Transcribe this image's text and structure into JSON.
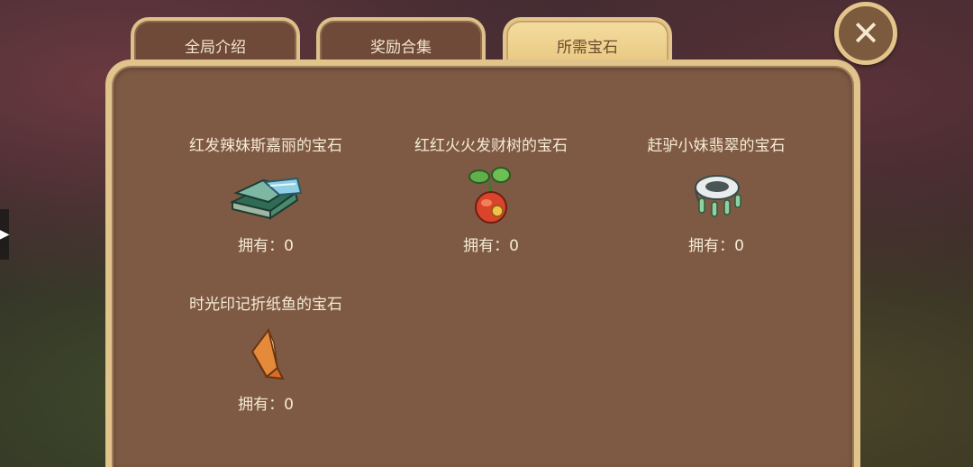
{
  "tabs": [
    {
      "label": "全局介绍",
      "active": false
    },
    {
      "label": "奖励合集",
      "active": false
    },
    {
      "label": "所需宝石",
      "active": true
    }
  ],
  "close_label": "✕",
  "gems": [
    {
      "name": "红发辣妹斯嘉丽的宝石",
      "owned": "拥有：0",
      "icon": "green-book-gem-icon"
    },
    {
      "name": "红红火火发财树的宝石",
      "owned": "拥有：0",
      "icon": "money-tree-pot-gem-icon"
    },
    {
      "name": "赶驴小妹翡翠的宝石",
      "owned": "拥有：0",
      "icon": "jade-bracelet-gem-icon"
    },
    {
      "name": "时光印记折纸鱼的宝石",
      "owned": "拥有：0",
      "icon": "origami-fish-gem-icon"
    }
  ],
  "colors": {
    "panel_bg": "#7e5a44",
    "panel_border": "#e1c38c",
    "tab_active": "#e7c57e",
    "text": "#f5ead4"
  }
}
